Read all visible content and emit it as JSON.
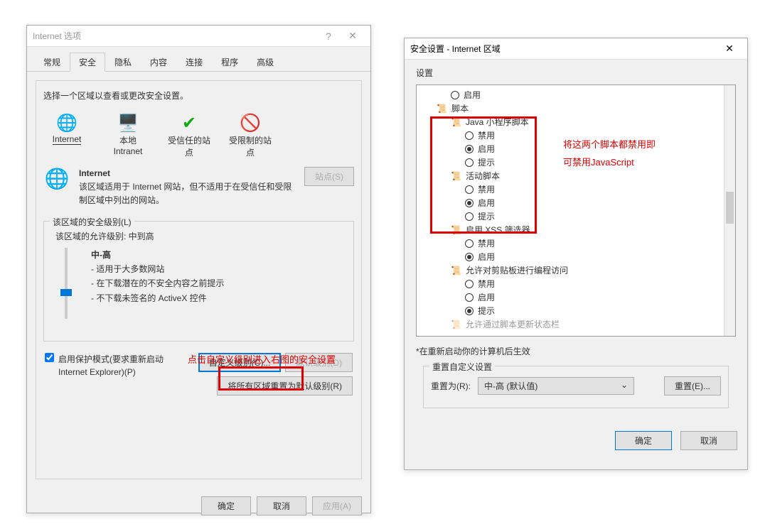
{
  "dialog1": {
    "title": "Internet 选项",
    "tabs": [
      "常规",
      "安全",
      "隐私",
      "内容",
      "连接",
      "程序",
      "高级"
    ],
    "activeTab": 1,
    "zone_prompt": "选择一个区域以查看或更改安全设置。",
    "zones": [
      {
        "label": "Internet",
        "icon": "globe"
      },
      {
        "label": "本地 Intranet",
        "icon": "lan"
      },
      {
        "label": "受信任的站点",
        "icon": "check"
      },
      {
        "label": "受限制的站点",
        "icon": "deny"
      }
    ],
    "zone_detail": {
      "name": "Internet",
      "desc": "该区域适用于 Internet 网站，但不适用于在受信任和受限制区域中列出的网站。",
      "sites_btn": "站点(S)"
    },
    "security_group": {
      "legend": "该区域的安全级别(L)",
      "allowed": "该区域的允许级别: 中到高",
      "level": "中-高",
      "bullets": [
        "- 适用于大多数网站",
        "- 在下载潜在的不安全内容之前提示",
        "- 不下载未签名的 ActiveX 控件"
      ],
      "checkbox": "启用保护模式(要求重新启动 Internet Explorer)(P)",
      "custom_btn": "自定义级别(C)...",
      "default_btn": "默认级别(D)",
      "reset_all_btn": "将所有区域重置为默认级别(R)"
    },
    "footer": {
      "ok": "确定",
      "cancel": "取消",
      "apply": "应用(A)"
    }
  },
  "dialog2": {
    "title": "安全设置 - Internet 区域",
    "settings_label": "设置",
    "tree": {
      "enable_top": "启用",
      "scripts": "脚本",
      "java_script": "Java 小程序脚本",
      "active_script": "活动脚本",
      "disable": "禁用",
      "enable": "启用",
      "prompt": "提示",
      "xss": "启用 XSS 筛选器",
      "clipboard": "允许对剪贴板进行编程访问",
      "truncated": "允许通过脚本更新状态栏"
    },
    "restart_note": "*在重新启动你的计算机后生效",
    "reset_custom": {
      "legend": "重置自定义设置",
      "reset_to": "重置为(R):",
      "select_value": "中-高 (默认值)",
      "reset_btn": "重置(E)..."
    },
    "footer": {
      "ok": "确定",
      "cancel": "取消"
    }
  },
  "annotations": {
    "custom_level_note": "点击自定义级别进入右图的安全设置",
    "scripts_note1": "将这两个脚本都禁用即",
    "scripts_note2": "可禁用JavaScript"
  }
}
